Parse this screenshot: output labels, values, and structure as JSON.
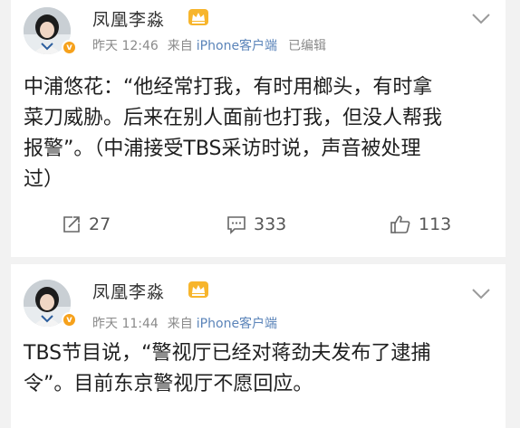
{
  "posts": [
    {
      "user": "凤凰李淼",
      "time": "昨天 12:46",
      "source_prefix": "来自",
      "device": "iPhone客户端",
      "edited": "已编辑",
      "lines": [
        "中浦悠花：“他经常打我，有时用榔头，有时拿",
        "菜刀威胁。后来在别人面前也打我，但没人帮我",
        "报警”。（中浦接受TBS采访时说，声音被处理",
        "过）"
      ],
      "reposts": "27",
      "comments": "333",
      "likes": "113"
    },
    {
      "user": "凤凰李淼",
      "time": "昨天 11:44",
      "source_prefix": "来自",
      "device": "iPhone客户端",
      "lines": [
        "TBS节目说，“警视厅已经对蒋劲夫发布了逮捕",
        "令”。目前东京警视厅不愿回应。"
      ]
    }
  ],
  "colors": {
    "link": "#5b84b9",
    "meta": "#8a8a8a",
    "verified": "#f6a11b",
    "vip_crown": "#f7b52c"
  },
  "icons": {
    "verified": "verified-badge-icon",
    "vip": "crown-icon",
    "menu": "chevron-down-icon",
    "repost": "repost-icon",
    "comment": "comment-icon",
    "like": "thumbs-up-icon"
  }
}
